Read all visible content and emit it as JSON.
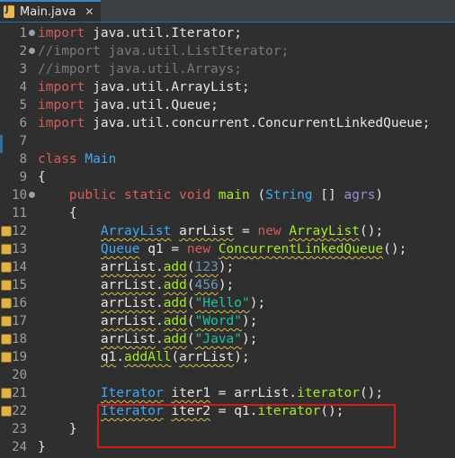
{
  "tab": {
    "title": "Main.java",
    "close": "✕"
  },
  "lines": [
    {
      "n": "1",
      "fold": true,
      "warn": false,
      "tokens": [
        [
          "kw",
          "import"
        ],
        [
          "var",
          " java.util.Iterator;"
        ]
      ]
    },
    {
      "n": "2",
      "fold": true,
      "warn": false,
      "tokens": [
        [
          "comment",
          "//import java.util.ListIterator;"
        ]
      ]
    },
    {
      "n": "3",
      "fold": false,
      "warn": false,
      "tokens": [
        [
          "comment",
          "//import java.util.Arrays;"
        ]
      ]
    },
    {
      "n": "4",
      "fold": false,
      "warn": false,
      "tokens": [
        [
          "kw",
          "import"
        ],
        [
          "var",
          " java.util.ArrayList;"
        ]
      ]
    },
    {
      "n": "5",
      "fold": false,
      "warn": false,
      "tokens": [
        [
          "kw",
          "import"
        ],
        [
          "var",
          " java.util.Queue;"
        ]
      ]
    },
    {
      "n": "6",
      "fold": false,
      "warn": false,
      "tokens": [
        [
          "kw",
          "import"
        ],
        [
          "var",
          " java.util.concurrent.ConcurrentLinkedQueue;"
        ]
      ]
    },
    {
      "n": "7",
      "fold": false,
      "warn": false,
      "tokens": []
    },
    {
      "n": "8",
      "fold": false,
      "warn": false,
      "tokens": [
        [
          "kw",
          "class"
        ],
        [
          "var",
          " "
        ],
        [
          "type",
          "Main"
        ]
      ]
    },
    {
      "n": "9",
      "fold": false,
      "warn": false,
      "tokens": [
        [
          "var",
          "{"
        ]
      ]
    },
    {
      "n": "10",
      "fold": true,
      "warn": false,
      "tokens": [
        [
          "var",
          "    "
        ],
        [
          "kw",
          "public static void"
        ],
        [
          "var",
          " "
        ],
        [
          "method",
          "main"
        ],
        [
          "var",
          " ("
        ],
        [
          "type",
          "String"
        ],
        [
          "var",
          " [] "
        ],
        [
          "param",
          "agrs"
        ],
        [
          "var",
          ")"
        ]
      ]
    },
    {
      "n": "11",
      "fold": false,
      "warn": false,
      "tokens": [
        [
          "var",
          "    {"
        ]
      ]
    },
    {
      "n": "12",
      "fold": false,
      "warn": true,
      "tokens": [
        [
          "var",
          "        "
        ],
        [
          "type squig",
          "ArrayList"
        ],
        [
          "var",
          " "
        ],
        [
          "var squig",
          "arrList"
        ],
        [
          "var",
          " = "
        ],
        [
          "kw",
          "new"
        ],
        [
          "var",
          " "
        ],
        [
          "method squig",
          "ArrayList"
        ],
        [
          "var",
          "();"
        ]
      ]
    },
    {
      "n": "13",
      "fold": false,
      "warn": true,
      "tokens": [
        [
          "var",
          "        "
        ],
        [
          "type squig",
          "Queue"
        ],
        [
          "var",
          " q1 = "
        ],
        [
          "kw",
          "new"
        ],
        [
          "var",
          " "
        ],
        [
          "method squig",
          "ConcurrentLinkedQueue"
        ],
        [
          "var",
          "();"
        ]
      ]
    },
    {
      "n": "14",
      "fold": false,
      "warn": true,
      "tokens": [
        [
          "var",
          "        "
        ],
        [
          "var squig",
          "arrList"
        ],
        [
          "var",
          "."
        ],
        [
          "method squig",
          "add"
        ],
        [
          "var",
          "("
        ],
        [
          "num squig",
          "123"
        ],
        [
          "var",
          ");"
        ]
      ]
    },
    {
      "n": "15",
      "fold": false,
      "warn": true,
      "tokens": [
        [
          "var",
          "        "
        ],
        [
          "var squig",
          "arrList"
        ],
        [
          "var",
          "."
        ],
        [
          "method squig",
          "add"
        ],
        [
          "var",
          "("
        ],
        [
          "num squig",
          "456"
        ],
        [
          "var",
          ");"
        ]
      ]
    },
    {
      "n": "16",
      "fold": false,
      "warn": true,
      "tokens": [
        [
          "var",
          "        "
        ],
        [
          "var squig",
          "arrList"
        ],
        [
          "var",
          "."
        ],
        [
          "method squig",
          "add"
        ],
        [
          "var",
          "("
        ],
        [
          "str squig",
          "\"Hello\""
        ],
        [
          "var",
          ");"
        ]
      ]
    },
    {
      "n": "17",
      "fold": false,
      "warn": true,
      "tokens": [
        [
          "var",
          "        "
        ],
        [
          "var squig",
          "arrList"
        ],
        [
          "var",
          "."
        ],
        [
          "method squig",
          "add"
        ],
        [
          "var",
          "("
        ],
        [
          "str squig",
          "\"Word\""
        ],
        [
          "var",
          ");"
        ]
      ]
    },
    {
      "n": "18",
      "fold": false,
      "warn": true,
      "tokens": [
        [
          "var",
          "        "
        ],
        [
          "var squig",
          "arrList"
        ],
        [
          "var",
          "."
        ],
        [
          "method squig",
          "add"
        ],
        [
          "var",
          "("
        ],
        [
          "str squig",
          "\"Java\""
        ],
        [
          "var",
          ");"
        ]
      ]
    },
    {
      "n": "19",
      "fold": false,
      "warn": true,
      "tokens": [
        [
          "var",
          "        "
        ],
        [
          "var squig",
          "q1"
        ],
        [
          "var",
          "."
        ],
        [
          "method squig",
          "addAll"
        ],
        [
          "var",
          "("
        ],
        [
          "var squig",
          "arrList"
        ],
        [
          "var",
          ");"
        ]
      ]
    },
    {
      "n": "20",
      "fold": false,
      "warn": false,
      "tokens": []
    },
    {
      "n": "21",
      "fold": false,
      "warn": true,
      "tokens": [
        [
          "var",
          "        "
        ],
        [
          "type squig",
          "Iterator"
        ],
        [
          "var",
          " "
        ],
        [
          "var squig",
          "iter1"
        ],
        [
          "var",
          " = arrList."
        ],
        [
          "method",
          "iterator"
        ],
        [
          "var",
          "();"
        ]
      ]
    },
    {
      "n": "22",
      "fold": false,
      "warn": true,
      "tokens": [
        [
          "var",
          "        "
        ],
        [
          "type squig",
          "Iterator"
        ],
        [
          "var",
          " "
        ],
        [
          "var squig",
          "iter2"
        ],
        [
          "var",
          " = q1."
        ],
        [
          "method",
          "iterator"
        ],
        [
          "var",
          "();"
        ]
      ]
    },
    {
      "n": "23",
      "fold": false,
      "warn": false,
      "tokens": [
        [
          "var",
          "    }"
        ]
      ]
    },
    {
      "n": "24",
      "fold": false,
      "warn": false,
      "tokens": [
        [
          "var",
          "}"
        ]
      ]
    }
  ],
  "colors": {
    "keyword": "#d65c5c",
    "type": "#3fa9f5",
    "method": "#a7ec21",
    "string": "#17c6a3",
    "number": "#6897bb",
    "highlight_box": "#d11c1c"
  }
}
